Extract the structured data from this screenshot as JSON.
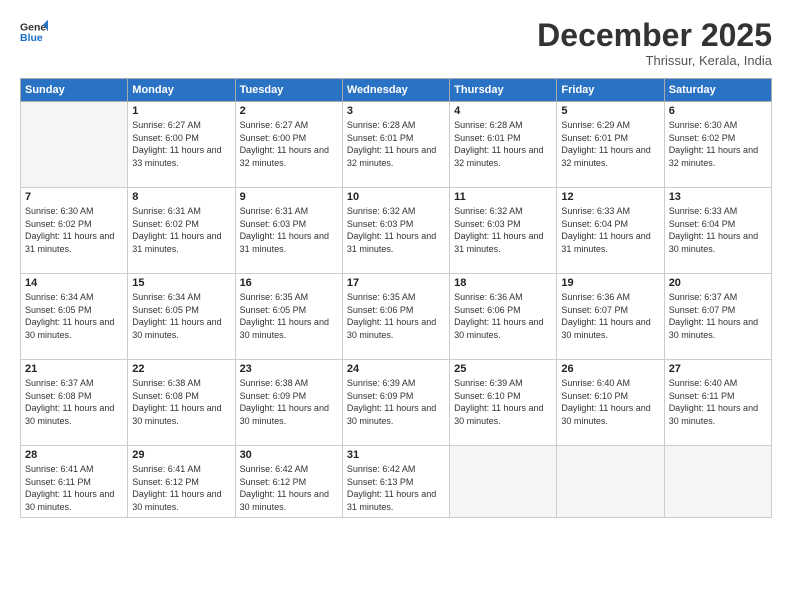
{
  "logo": {
    "line1": "General",
    "line2": "Blue"
  },
  "title": "December 2025",
  "location": "Thrissur, Kerala, India",
  "weekdays": [
    "Sunday",
    "Monday",
    "Tuesday",
    "Wednesday",
    "Thursday",
    "Friday",
    "Saturday"
  ],
  "weeks": [
    [
      {
        "day": "",
        "empty": true
      },
      {
        "day": "1",
        "sunrise": "6:27 AM",
        "sunset": "6:00 PM",
        "daylight": "11 hours and 33 minutes."
      },
      {
        "day": "2",
        "sunrise": "6:27 AM",
        "sunset": "6:00 PM",
        "daylight": "11 hours and 32 minutes."
      },
      {
        "day": "3",
        "sunrise": "6:28 AM",
        "sunset": "6:01 PM",
        "daylight": "11 hours and 32 minutes."
      },
      {
        "day": "4",
        "sunrise": "6:28 AM",
        "sunset": "6:01 PM",
        "daylight": "11 hours and 32 minutes."
      },
      {
        "day": "5",
        "sunrise": "6:29 AM",
        "sunset": "6:01 PM",
        "daylight": "11 hours and 32 minutes."
      },
      {
        "day": "6",
        "sunrise": "6:30 AM",
        "sunset": "6:02 PM",
        "daylight": "11 hours and 32 minutes."
      }
    ],
    [
      {
        "day": "7",
        "sunrise": "6:30 AM",
        "sunset": "6:02 PM",
        "daylight": "11 hours and 31 minutes."
      },
      {
        "day": "8",
        "sunrise": "6:31 AM",
        "sunset": "6:02 PM",
        "daylight": "11 hours and 31 minutes."
      },
      {
        "day": "9",
        "sunrise": "6:31 AM",
        "sunset": "6:03 PM",
        "daylight": "11 hours and 31 minutes."
      },
      {
        "day": "10",
        "sunrise": "6:32 AM",
        "sunset": "6:03 PM",
        "daylight": "11 hours and 31 minutes."
      },
      {
        "day": "11",
        "sunrise": "6:32 AM",
        "sunset": "6:03 PM",
        "daylight": "11 hours and 31 minutes."
      },
      {
        "day": "12",
        "sunrise": "6:33 AM",
        "sunset": "6:04 PM",
        "daylight": "11 hours and 31 minutes."
      },
      {
        "day": "13",
        "sunrise": "6:33 AM",
        "sunset": "6:04 PM",
        "daylight": "11 hours and 30 minutes."
      }
    ],
    [
      {
        "day": "14",
        "sunrise": "6:34 AM",
        "sunset": "6:05 PM",
        "daylight": "11 hours and 30 minutes."
      },
      {
        "day": "15",
        "sunrise": "6:34 AM",
        "sunset": "6:05 PM",
        "daylight": "11 hours and 30 minutes."
      },
      {
        "day": "16",
        "sunrise": "6:35 AM",
        "sunset": "6:05 PM",
        "daylight": "11 hours and 30 minutes."
      },
      {
        "day": "17",
        "sunrise": "6:35 AM",
        "sunset": "6:06 PM",
        "daylight": "11 hours and 30 minutes."
      },
      {
        "day": "18",
        "sunrise": "6:36 AM",
        "sunset": "6:06 PM",
        "daylight": "11 hours and 30 minutes."
      },
      {
        "day": "19",
        "sunrise": "6:36 AM",
        "sunset": "6:07 PM",
        "daylight": "11 hours and 30 minutes."
      },
      {
        "day": "20",
        "sunrise": "6:37 AM",
        "sunset": "6:07 PM",
        "daylight": "11 hours and 30 minutes."
      }
    ],
    [
      {
        "day": "21",
        "sunrise": "6:37 AM",
        "sunset": "6:08 PM",
        "daylight": "11 hours and 30 minutes."
      },
      {
        "day": "22",
        "sunrise": "6:38 AM",
        "sunset": "6:08 PM",
        "daylight": "11 hours and 30 minutes."
      },
      {
        "day": "23",
        "sunrise": "6:38 AM",
        "sunset": "6:09 PM",
        "daylight": "11 hours and 30 minutes."
      },
      {
        "day": "24",
        "sunrise": "6:39 AM",
        "sunset": "6:09 PM",
        "daylight": "11 hours and 30 minutes."
      },
      {
        "day": "25",
        "sunrise": "6:39 AM",
        "sunset": "6:10 PM",
        "daylight": "11 hours and 30 minutes."
      },
      {
        "day": "26",
        "sunrise": "6:40 AM",
        "sunset": "6:10 PM",
        "daylight": "11 hours and 30 minutes."
      },
      {
        "day": "27",
        "sunrise": "6:40 AM",
        "sunset": "6:11 PM",
        "daylight": "11 hours and 30 minutes."
      }
    ],
    [
      {
        "day": "28",
        "sunrise": "6:41 AM",
        "sunset": "6:11 PM",
        "daylight": "11 hours and 30 minutes."
      },
      {
        "day": "29",
        "sunrise": "6:41 AM",
        "sunset": "6:12 PM",
        "daylight": "11 hours and 30 minutes."
      },
      {
        "day": "30",
        "sunrise": "6:42 AM",
        "sunset": "6:12 PM",
        "daylight": "11 hours and 30 minutes."
      },
      {
        "day": "31",
        "sunrise": "6:42 AM",
        "sunset": "6:13 PM",
        "daylight": "11 hours and 31 minutes."
      },
      {
        "day": "",
        "empty": true
      },
      {
        "day": "",
        "empty": true
      },
      {
        "day": "",
        "empty": true
      }
    ]
  ]
}
